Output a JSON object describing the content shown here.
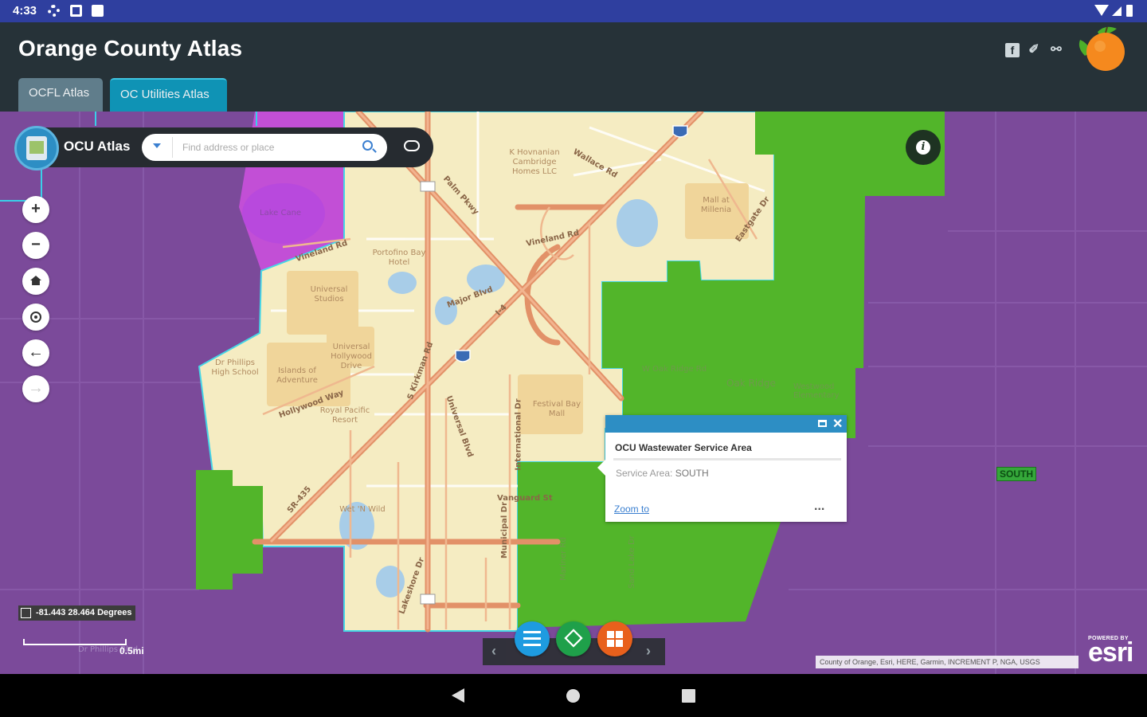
{
  "status_bar": {
    "time": "4:33"
  },
  "header": {
    "title": "Orange County Atlas",
    "social_icons": [
      "facebook-icon",
      "twitter-icon",
      "link-icon"
    ],
    "tabs": [
      {
        "label": "OCFL Atlas",
        "active": false
      },
      {
        "label": "OC Utilities Atlas",
        "active": true
      }
    ]
  },
  "colors": {
    "header_bg": "#263238",
    "status_bg": "#2f3f9f",
    "outside_area": "#7b4a9a",
    "south_service": "#52b52a",
    "basemap": "#f5ecc2",
    "roads": "#e8956b",
    "popup_header": "#2d8ec4"
  },
  "search": {
    "atlas_name": "OCU Atlas",
    "placeholder": "Find address or place"
  },
  "map": {
    "labels": {
      "lake_cane": "Lake Cane",
      "vineland": "Vineland Rd",
      "palm_pkwy": "Palm Pkwy",
      "kh_cambridge": "K Hovnanian Cambridge Homes LLC",
      "wallace": "Wallace Rd",
      "vineland2": "Vineland Rd",
      "mall_millenia": "Mall at Millenia",
      "eastgate": "Eastgate Dr",
      "doubletree": "Portofino Bay Hotel",
      "universal": "Universal Studios",
      "major": "Major Blvd",
      "i4": "I-4",
      "univ_hollywood": "Universal Hollywood Drive",
      "islands": "Islands of Adventure",
      "dr_phillips_hs": "Dr Phillips High School",
      "hollywood_way": "Hollywood Way",
      "royal_pacific": "Royal Pacific Resort",
      "kirkman": "S Kirkman Rd",
      "ocu_pkwy": "Universal Blvd",
      "festival": "Festival Bay Mall",
      "intl_dr": "International Dr",
      "oak_ridge_rd": "W Oak Ridge Rd",
      "oak_ridge": "Oak Ridge",
      "lake_willis": "Westwood Elementary",
      "sr_435": "SR-435",
      "sand_lake": "Sand Lake",
      "municipal": "Municipal Dr",
      "lakeshore": "Lakeshore Dr",
      "vanguard": "Vanguard St",
      "hawks_rd": "Kirkman Rd",
      "mariner": "Mariner Rd",
      "sand_lake_dr": "Sand Lake Dr",
      "wet_n_wild": "Wet 'N Wild",
      "dr_phillips_blvd": "Dr Phillips Blvd"
    },
    "south_badge": "SOUTH",
    "coordinates": "-81.443 28.464 Degrees",
    "scale_label": "0.5mi",
    "attribution": "County of Orange, Esri, HERE, Garmin, INCREMENT P, NGA, USGS",
    "esri_powered": "POWERED BY",
    "esri_word": "esri"
  },
  "tools": [
    "zoom-in",
    "zoom-out",
    "home",
    "locate",
    "back",
    "forward"
  ],
  "popup": {
    "title": "OCU Wastewater Service Area",
    "field_label": "Service Area:",
    "field_value": "SOUTH",
    "zoom_link": "Zoom to",
    "more": "..."
  }
}
